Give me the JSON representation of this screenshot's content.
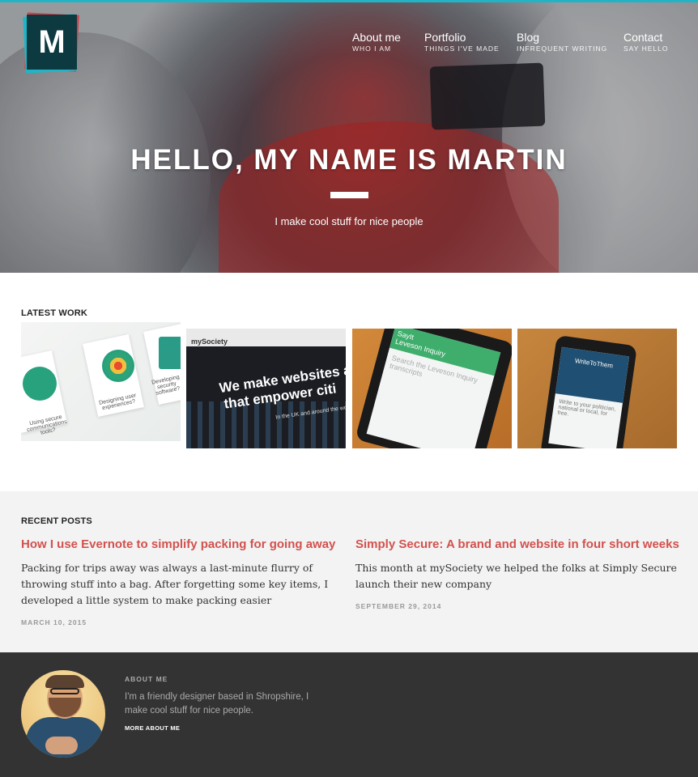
{
  "logo": {
    "letter": "M"
  },
  "nav": [
    {
      "label": "About me",
      "sub": "WHO I AM"
    },
    {
      "label": "Portfolio",
      "sub": "THINGS I'VE MADE"
    },
    {
      "label": "Blog",
      "sub": "INFREQUENT WRITING"
    },
    {
      "label": "Contact",
      "sub": "SAY HELLO"
    }
  ],
  "hero": {
    "title": "HELLO, MY NAME IS MARTIN",
    "subtitle": "I make cool stuff for nice people"
  },
  "latest_work": {
    "label": "LATEST WORK",
    "items": [
      {
        "thumb_texts": [
          "Using secure communications tools?",
          "Designing user experiences?",
          "Developing security software?"
        ]
      },
      {
        "brand": "mySociety",
        "headline_1": "We make websites an",
        "headline_2": "that empower citi",
        "tagline": "In the UK and around the world"
      },
      {
        "screen_header": "SayIt",
        "screen_title": "Leveson Inquiry",
        "screen_body": "Search the Leveson Inquiry transcripts"
      },
      {
        "screen_header": "WriteToThem",
        "screen_title": "Write to your politician, national or local, for free."
      }
    ]
  },
  "recent_posts": {
    "label": "RECENT POSTS",
    "posts": [
      {
        "title": "How I use Evernote to simplify packing for going away",
        "excerpt": "Packing for trips away was always a last-minute flurry of throwing stuff into a bag. After forgetting some key items, I developed a little system to make packing easier",
        "date": "MARCH 10, 2015"
      },
      {
        "title": "Simply Secure: A brand and website in four short weeks",
        "excerpt": "This month at mySociety we helped the folks at Simply Secure launch their new company",
        "date": "SEPTEMBER 29, 2014"
      }
    ]
  },
  "about": {
    "label": "ABOUT ME",
    "text": "I'm a friendly designer based in Shropshire, I make cool stuff for nice people.",
    "link": "MORE ABOUT ME"
  },
  "colors": {
    "accent": "#d2514d",
    "topline": "#22b4c6",
    "logo_bg": "#0d3a40",
    "footer_bg": "#333333",
    "recent_bg": "#f3f3f3"
  }
}
